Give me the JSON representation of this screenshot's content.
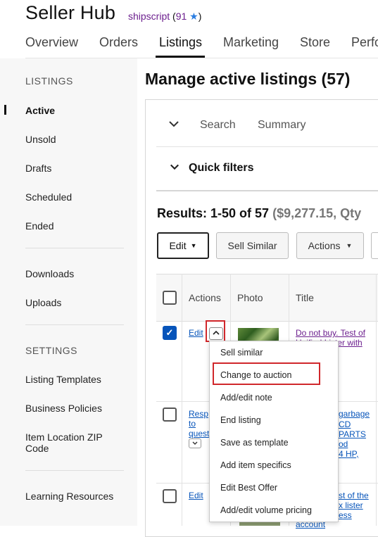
{
  "header": {
    "brand": "Seller Hub",
    "user": "shipscript",
    "feedback_open": "(",
    "feedback_score": "91",
    "feedback_close": ")",
    "star": "★"
  },
  "tabs": [
    "Overview",
    "Orders",
    "Listings",
    "Marketing",
    "Store",
    "Perfo"
  ],
  "sidebar": {
    "listings_heading": "LISTINGS",
    "listing_items": [
      "Active",
      "Unsold",
      "Drafts",
      "Scheduled",
      "Ended"
    ],
    "file_items": [
      "Downloads",
      "Uploads"
    ],
    "settings_heading": "SETTINGS",
    "settings_items": [
      "Listing Templates",
      "Business Policies",
      "Item Location ZIP",
      "Code"
    ],
    "learning": "Learning Resources"
  },
  "main": {
    "title": "Manage active listings (57)",
    "panel_tabs": [
      "Search",
      "Summary"
    ],
    "quick_filters": "Quick filters",
    "results_label": "Results: 1-50 of 57",
    "results_summary": "($9,277.15, Qty",
    "buttons": {
      "edit": "Edit",
      "sell_similar": "Sell Similar",
      "actions": "Actions"
    },
    "columns": [
      "Actions",
      "Photo",
      "Title"
    ]
  },
  "rows": [
    {
      "checked": true,
      "action": "Edit",
      "title_lines": [
        "Do not buy. Test of",
        "Unified Lister with"
      ]
    },
    {
      "checked": false,
      "action_lines": [
        "Resp",
        "to",
        "quest"
      ],
      "title_lines": [
        "garbage",
        "CD",
        "PARTS",
        "od",
        "4 HP,"
      ]
    },
    {
      "checked": false,
      "action": "Edit",
      "title_lines": [
        "st of the",
        "x lister",
        "ess",
        "account"
      ]
    }
  ],
  "menu": {
    "items": [
      "Sell similar",
      "Change to auction",
      "Add/edit note",
      "End listing",
      "Save as template",
      "Add item specifics",
      "Edit Best Offer",
      "Add/edit volume pricing"
    ],
    "highlighted": "Change to auction"
  },
  "icons": {
    "chevron_down": "chevron-down-icon",
    "chevron_up": "chevron-up-icon",
    "caret_down": "caret-down-icon",
    "check": "check-icon",
    "star": "star-icon"
  },
  "colors": {
    "link": "#0654ba",
    "visited_link": "#6c1f8e",
    "highlight_box": "#d0272b",
    "checkbox_checked": "#0654ba"
  }
}
